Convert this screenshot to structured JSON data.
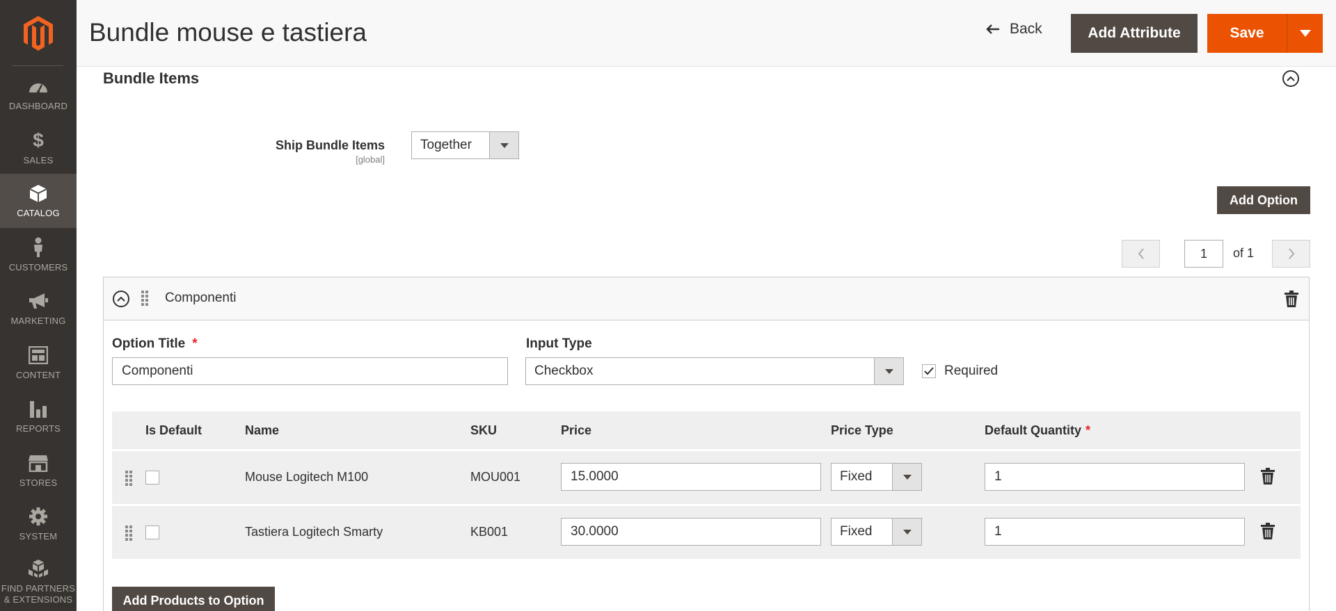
{
  "app": {
    "brand_color": "#eb5202",
    "sidebar_color": "#373330",
    "logo": "magento-logo"
  },
  "sidebar": {
    "items": [
      {
        "label": "DASHBOARD",
        "icon": "dashboard-icon"
      },
      {
        "label": "SALES",
        "icon": "dollar-icon"
      },
      {
        "label": "CATALOG",
        "icon": "catalog-box-icon",
        "active": true
      },
      {
        "label": "CUSTOMERS",
        "icon": "person-icon"
      },
      {
        "label": "MARKETING",
        "icon": "megaphone-icon"
      },
      {
        "label": "CONTENT",
        "icon": "content-layout-icon"
      },
      {
        "label": "REPORTS",
        "icon": "bar-chart-icon"
      },
      {
        "label": "STORES",
        "icon": "storefront-icon"
      },
      {
        "label": "SYSTEM",
        "icon": "gear-icon"
      },
      {
        "label": "FIND PARTNERS & EXTENSIONS",
        "icon": "extensions-boxes-icon"
      }
    ]
  },
  "header": {
    "title": "Bundle mouse e tastiera",
    "back_label": "Back",
    "add_attribute_label": "Add Attribute",
    "save_label": "Save"
  },
  "section": {
    "title": "Bundle Items",
    "ship_label": "Ship Bundle Items",
    "ship_scope": "[global]",
    "ship_value": "Together",
    "add_option_label": "Add Option",
    "pager": {
      "page": "1",
      "of_label": "of 1"
    }
  },
  "option": {
    "name": "Componenti",
    "title_label": "Option Title",
    "title_value": "Componenti",
    "input_type_label": "Input Type",
    "input_type_value": "Checkbox",
    "required_label": "Required",
    "required_checked": true,
    "required_star": "*",
    "columns": {
      "is_default": "Is Default",
      "name": "Name",
      "sku": "SKU",
      "price": "Price",
      "price_type": "Price Type",
      "default_quantity": "Default Quantity"
    },
    "rows": [
      {
        "name": "Mouse Logitech M100",
        "sku": "MOU001",
        "price": "15.0000",
        "price_type": "Fixed",
        "qty": "1"
      },
      {
        "name": "Tastiera Logitech Smarty",
        "sku": "KB001",
        "price": "30.0000",
        "price_type": "Fixed",
        "qty": "1"
      }
    ],
    "add_products_label": "Add Products to Option"
  }
}
